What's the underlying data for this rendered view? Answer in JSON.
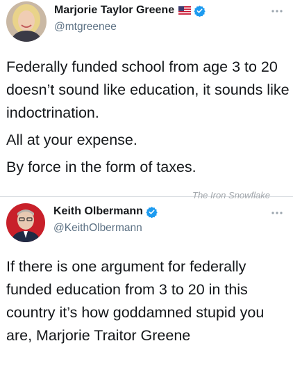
{
  "tweets": [
    {
      "display_name": "Marjorie Taylor Greene",
      "handle": "@mtgreenee",
      "avatar_icon": "profile-photo",
      "verified": true,
      "flag_icon": "us-flag-icon",
      "body": [
        "Federally funded school from age 3 to 20 doesn’t sound like education, it sounds like indoctrination.",
        "All at your expense.",
        "By force in the form of taxes."
      ]
    },
    {
      "display_name": "Keith Olbermann",
      "handle": "@KeithOlbermann",
      "avatar_icon": "profile-photo",
      "verified": true,
      "body": [
        "If there is one argument for federally funded education from 3 to 20 in this country it’s how goddamned stupid you are, Marjorie Traitor Greene"
      ]
    }
  ],
  "watermark": "The Iron Snowflake",
  "colors": {
    "verified_blue": "#1d9bf0",
    "handle_gray": "#5b7083",
    "text_black": "#14171a",
    "watermark_gray": "#a3a8ad"
  }
}
